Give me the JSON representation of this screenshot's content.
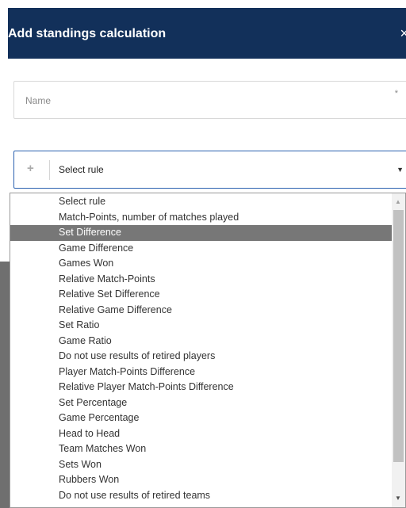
{
  "dialog": {
    "title": "Add standings calculation",
    "close_icon": "×"
  },
  "name_field": {
    "placeholder": "Name",
    "required_mark": "*"
  },
  "rule_select": {
    "add_icon": "+",
    "selected_value": "Select rule",
    "caret_icon": "▼"
  },
  "dropdown": {
    "highlighted": "Set Difference",
    "options": [
      "Select rule",
      "Match-Points, number of matches played",
      "Set Difference",
      "Game Difference",
      "Games Won",
      "Relative Match-Points",
      "Relative Set Difference",
      "Relative Game Difference",
      "Set Ratio",
      "Game Ratio",
      "Do not use results of retired players",
      "Player Match-Points Difference",
      "Relative Player Match-Points Difference",
      "Set Percentage",
      "Game Percentage",
      "Head to Head",
      "Team Matches Won",
      "Sets Won",
      "Rubbers Won",
      "Do not use results of retired teams"
    ],
    "scroll_up_icon": "▲",
    "scroll_down_icon": "▼"
  },
  "colors": {
    "header_bg": "#12305a",
    "highlight_bg": "#777777",
    "select_border": "#2b62b0"
  }
}
